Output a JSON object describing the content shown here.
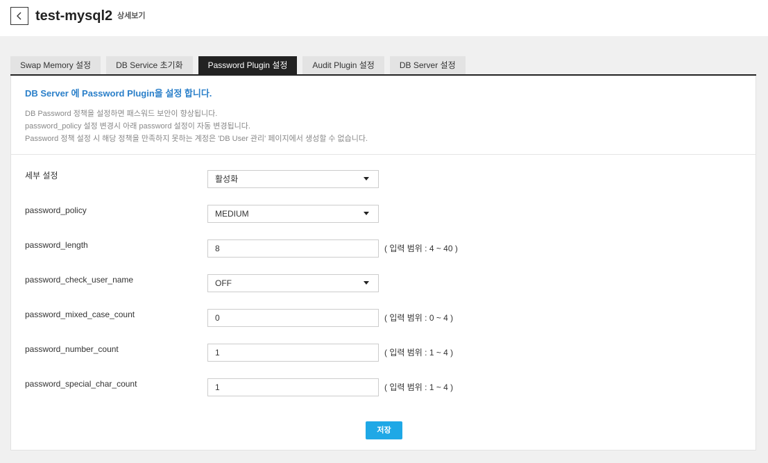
{
  "header": {
    "title": "test-mysql2",
    "subtitle": "상세보기",
    "back_icon": "chevron-left-icon"
  },
  "tabs": [
    {
      "label": "Swap Memory 설정",
      "active": false
    },
    {
      "label": "DB Service 초기화",
      "active": false
    },
    {
      "label": "Password Plugin 설정",
      "active": true
    },
    {
      "label": "Audit Plugin 설정",
      "active": false
    },
    {
      "label": "DB Server 설정",
      "active": false
    }
  ],
  "panel": {
    "heading": "DB Server 에 Password Plugin을 설정 합니다.",
    "description": [
      "DB Password 정책을 설정하면 패스워드 보안이 향상됩니다.",
      "password_policy 설정 변경시 아래 password 설정이 자동 변경됩니다.",
      "Password 정책 설정 시 해당 정책을 만족하지 못하는 계정은 'DB User 관리' 페이지에서 생성할 수 없습니다."
    ]
  },
  "fields": [
    {
      "label": "세부 설정",
      "type": "select",
      "value": "활성화",
      "hint": ""
    },
    {
      "label": "password_policy",
      "type": "select",
      "value": "MEDIUM",
      "hint": ""
    },
    {
      "label": "password_length",
      "type": "input",
      "value": "8",
      "hint": "( 입력 범위 : 4 ~ 40 )"
    },
    {
      "label": "password_check_user_name",
      "type": "select",
      "value": "OFF",
      "hint": ""
    },
    {
      "label": "password_mixed_case_count",
      "type": "input",
      "value": "0",
      "hint": "( 입력 범위 : 0 ~ 4 )"
    },
    {
      "label": "password_number_count",
      "type": "input",
      "value": "1",
      "hint": "( 입력 범위 : 1 ~ 4 )"
    },
    {
      "label": "password_special_char_count",
      "type": "input",
      "value": "1",
      "hint": "( 입력 범위 : 1 ~ 4 )"
    }
  ],
  "actions": {
    "save_label": "저장"
  },
  "colors": {
    "accent": "#1fa8e6",
    "heading": "#2a7fc9",
    "active_tab": "#222222"
  }
}
